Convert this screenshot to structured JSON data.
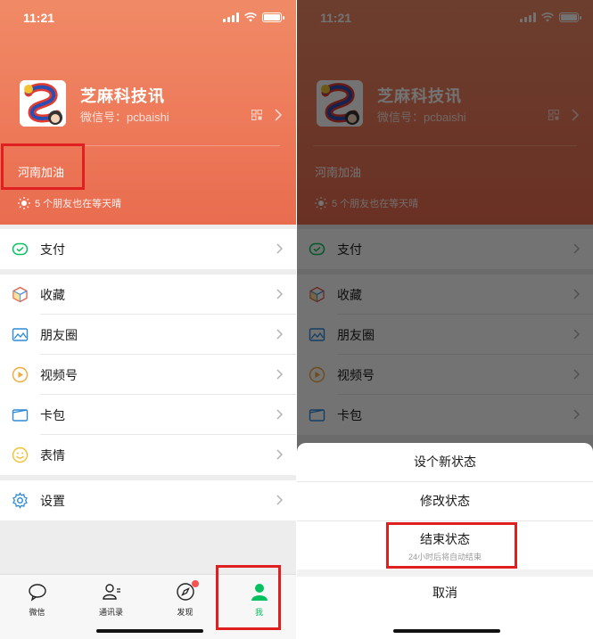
{
  "status_bar": {
    "time": "11:21"
  },
  "profile": {
    "name": "芝麻科技讯",
    "wechat_id": "微信号：pcbaishi",
    "status": "河南加油",
    "weather_text": "5 个朋友也在等天晴"
  },
  "menu": {
    "pay": "支付",
    "favorites": "收藏",
    "moments": "朋友圈",
    "channels": "视频号",
    "cards": "卡包",
    "stickers": "表情",
    "settings": "设置"
  },
  "tabbar": {
    "chats": "微信",
    "contacts": "通讯录",
    "discover": "发现",
    "me": "我"
  },
  "sheet": {
    "new_status": "设个新状态",
    "edit_status": "修改状态",
    "end_status": "结束状态",
    "end_status_note": "24小时后将自动结束",
    "cancel": "取消"
  },
  "colors": {
    "header": "#ee7d5c",
    "accent_green": "#07c160",
    "highlight_red": "#e02020",
    "badge_red": "#fa5151"
  },
  "icons": [
    "signal-icon",
    "wifi-icon",
    "battery-icon",
    "qr-code-icon",
    "chevron-right-icon",
    "sun-icon",
    "pay-icon",
    "favorites-icon",
    "moments-icon",
    "channels-icon",
    "cards-icon",
    "stickers-icon",
    "settings-icon",
    "chat-icon",
    "contacts-icon",
    "discover-icon",
    "me-icon"
  ]
}
